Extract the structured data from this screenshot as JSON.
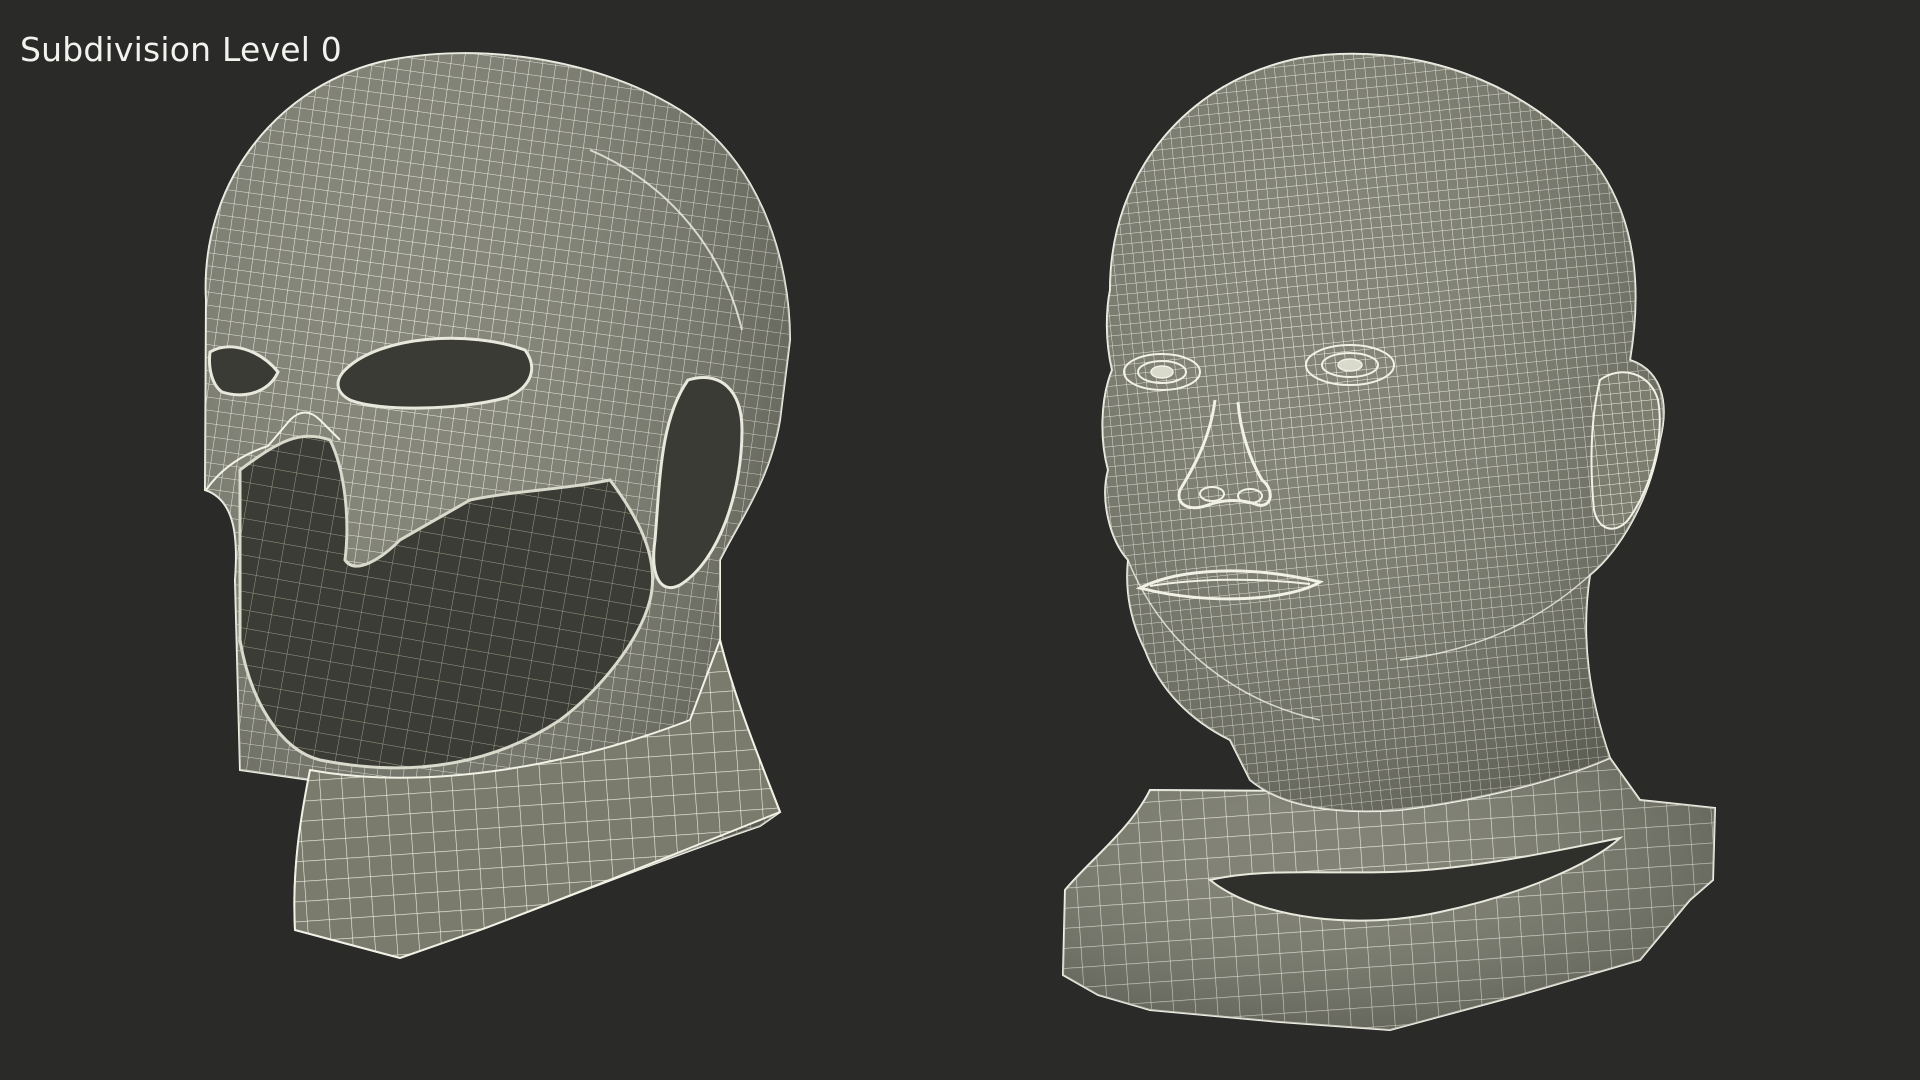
{
  "viewport": {
    "label": "Subdivision Level 0",
    "background_color": "#2a2a29"
  },
  "render": {
    "mesh_fill_color": "#7c7d6f",
    "wire_color": "#f1f1e6",
    "interior_color": "#3a3b35"
  }
}
